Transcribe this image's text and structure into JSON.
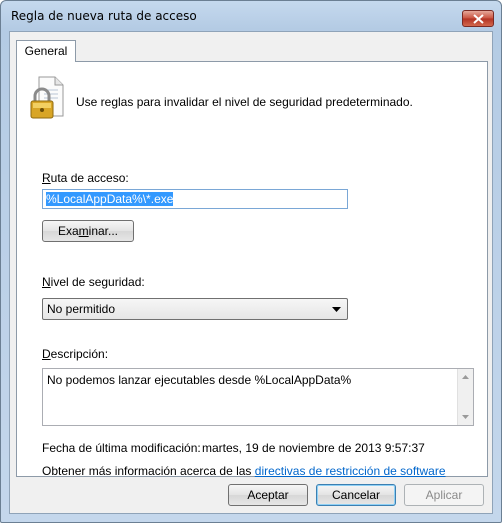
{
  "window": {
    "title": "Regla de nueva ruta de acceso"
  },
  "tabs": [
    {
      "label": "General"
    }
  ],
  "header": {
    "text": "Use reglas para invalidar el nivel de seguridad predeterminado.",
    "icon": "lock-document-icon"
  },
  "path": {
    "label_first": "R",
    "label_rest": "uta de acceso:",
    "value": "%LocalAppData%\\*.exe",
    "browse_first": "Exa",
    "browse_accel": "m",
    "browse_rest": "inar..."
  },
  "security": {
    "label_first": "N",
    "label_rest": "ivel de seguridad:",
    "selected": "No permitido"
  },
  "description": {
    "label_first": "D",
    "label_rest": "escripción:",
    "value": "No podemos lanzar ejecutables desde %LocalAppData%"
  },
  "modified": {
    "label": "Fecha de última modificación:",
    "value": "martes, 19 de noviembre de 2013  9:57:37"
  },
  "more_info": {
    "text": "Obtener más información acerca de las ",
    "link": "directivas de restricción de software"
  },
  "buttons": {
    "accept": "Aceptar",
    "cancel": "Cancelar",
    "apply": "Aplicar"
  },
  "colors": {
    "link": "#0066cc",
    "selection": "#3399ff",
    "close_button": "#c9503e"
  }
}
